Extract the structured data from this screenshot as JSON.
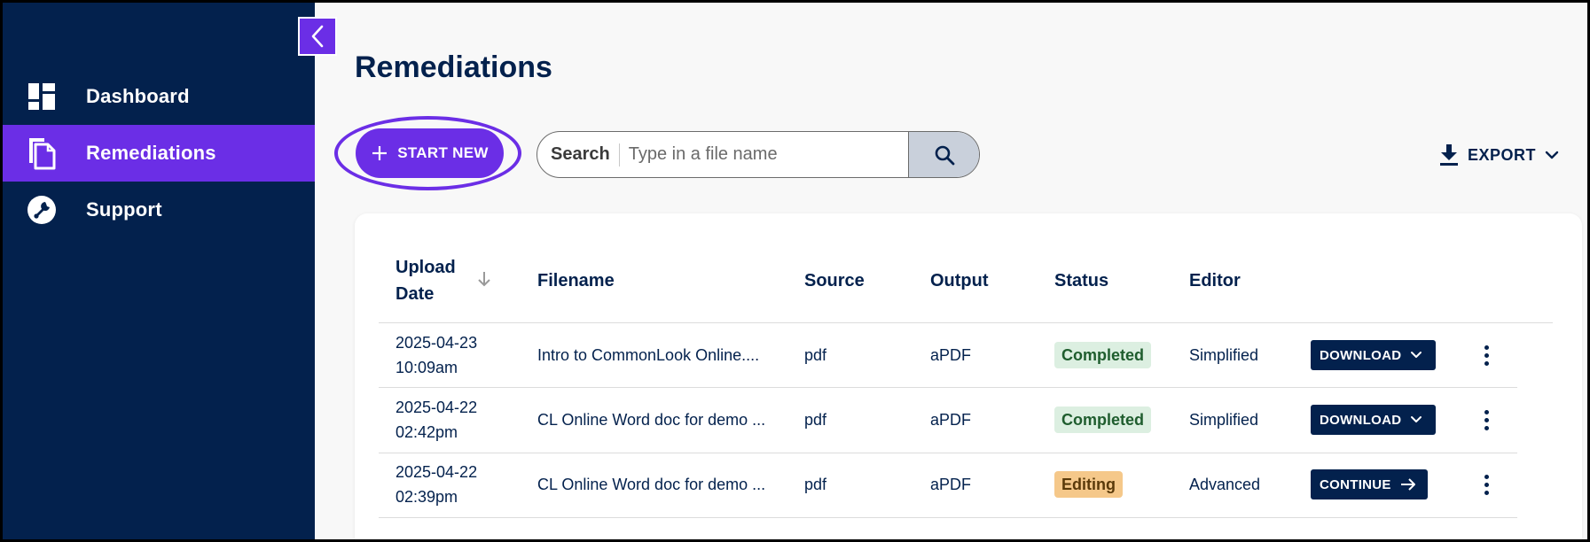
{
  "sidebar": {
    "items": [
      {
        "label": "Dashboard",
        "icon": "dashboard-icon",
        "active": false
      },
      {
        "label": "Remediations",
        "icon": "files-icon",
        "active": true
      },
      {
        "label": "Support",
        "icon": "wrench-icon",
        "active": false
      }
    ]
  },
  "main": {
    "title": "Remediations",
    "start_new_label": "START NEW",
    "search": {
      "label": "Search",
      "placeholder": "Type in a file name"
    },
    "export_label": "EXPORT"
  },
  "table": {
    "headers": {
      "upload_date_line1": "Upload",
      "upload_date_line2": "Date",
      "filename": "Filename",
      "source": "Source",
      "output": "Output",
      "status": "Status",
      "editor": "Editor"
    },
    "rows": [
      {
        "date": "2025-04-23",
        "time": "10:09am",
        "filename": "Intro to CommonLook Online....",
        "source": "pdf",
        "output": "aPDF",
        "status": "Completed",
        "editor": "Simplified",
        "action": "DOWNLOAD"
      },
      {
        "date": "2025-04-22",
        "time": "02:42pm",
        "filename": "CL Online Word doc for demo ...",
        "source": "pdf",
        "output": "aPDF",
        "status": "Completed",
        "editor": "Simplified",
        "action": "DOWNLOAD"
      },
      {
        "date": "2025-04-22",
        "time": "02:39pm",
        "filename": "CL Online Word doc for demo ...",
        "source": "pdf",
        "output": "aPDF",
        "status": "Editing",
        "editor": "Advanced",
        "action": "CONTINUE"
      }
    ]
  },
  "colors": {
    "sidebar_bg": "#03214d",
    "accent": "#6b2ee6",
    "completed_bg": "#dcefe1",
    "editing_bg": "#f5c88a"
  }
}
